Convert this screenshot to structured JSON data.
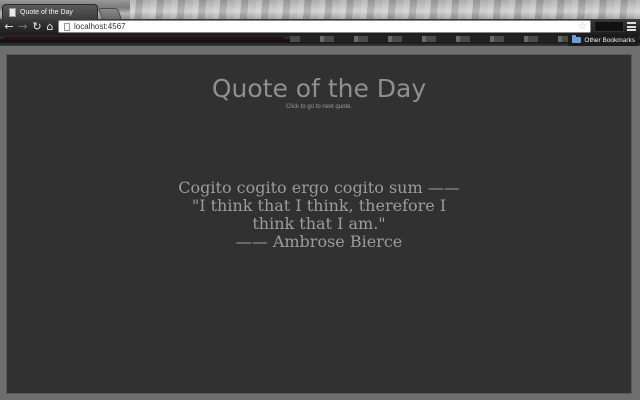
{
  "browser": {
    "tab": {
      "title": "Quote of the Day"
    },
    "nav": {
      "back": "←",
      "forward": "→",
      "reload": "↻",
      "home": "⌂"
    },
    "omnibox": {
      "url": "localhost:4567"
    },
    "star_icon": "☆",
    "bookmarks": {
      "other_label": "Other Bookmarks"
    }
  },
  "page": {
    "title": "Quote of the Day",
    "hint": "Click to go to next quote.",
    "quote": {
      "original": "Cogito cogito ergo cogito sum ——",
      "translation": "\"I think that I think, therefore I think that I am.\"",
      "author": "—— Ambrose Bierce"
    }
  },
  "colors": {
    "page_background": "#313131",
    "text": "#9c9c9c"
  }
}
